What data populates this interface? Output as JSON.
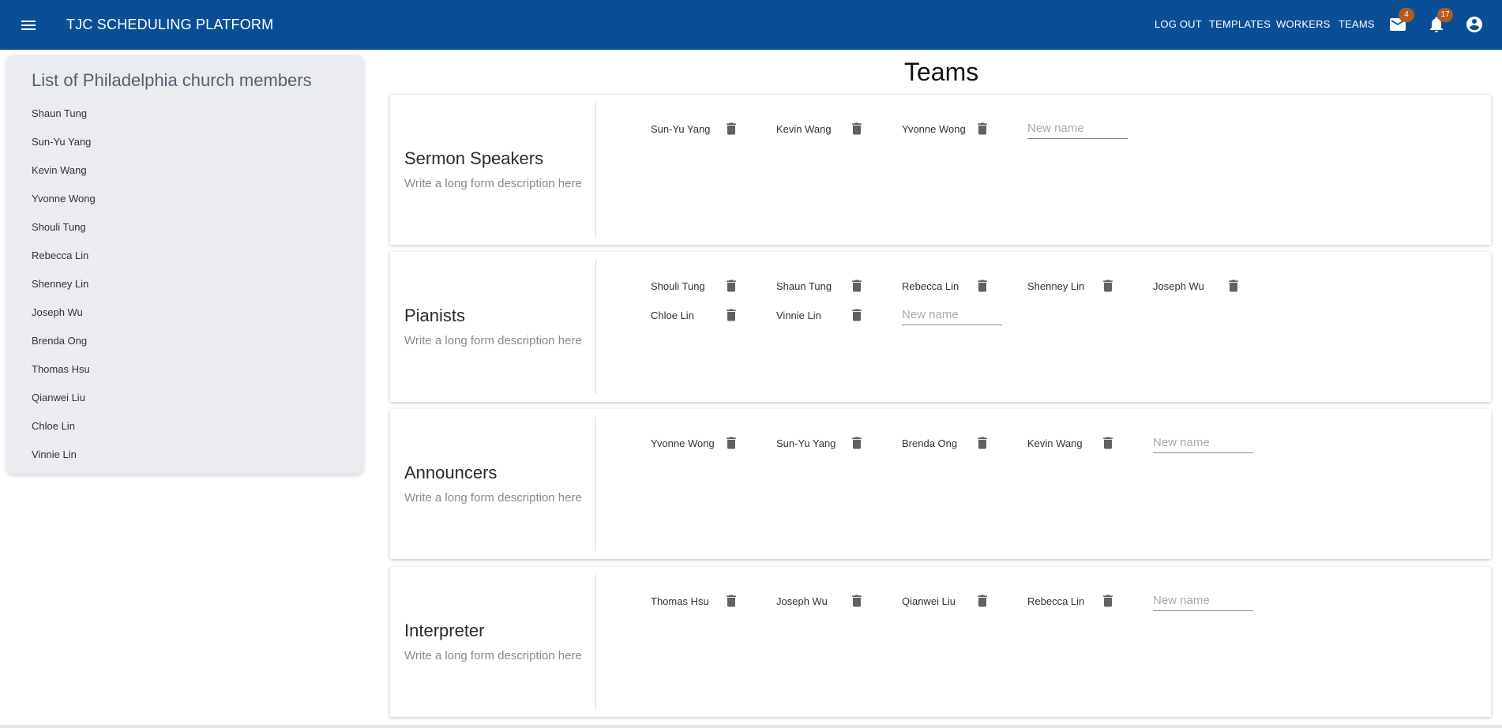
{
  "app": {
    "title": "TJC SCHEDULING PLATFORM",
    "nav": {
      "logout": "LOG OUT",
      "templates": "TEMPLATES",
      "workers": "WORKERS",
      "teams": "TEAMS"
    },
    "mail_badge": "4",
    "notification_badge": "17",
    "icons": {
      "menu": "hamburger-menu-icon",
      "mail": "mail-icon",
      "bell": "bell-icon",
      "account": "account-circle-icon",
      "delete": "trash-icon"
    },
    "colors": {
      "appbar": "#0a4f95",
      "badge": "#b35a1f",
      "panel": "#eaecf0"
    }
  },
  "members_panel": {
    "title": "List of Philadelphia church members",
    "members": [
      "Shaun Tung",
      "Sun-Yu Yang",
      "Kevin Wang",
      "Yvonne Wong",
      "Shouli Tung",
      "Rebecca Lin",
      "Shenney Lin",
      "Joseph Wu",
      "Brenda Ong",
      "Thomas Hsu",
      "Qianwei Liu",
      "Chloe Lin",
      "Vinnie Lin"
    ]
  },
  "page_title": "Teams",
  "new_name_placeholder": "New name",
  "teams": [
    {
      "name": "Sermon Speakers",
      "description": "Write a long form description here",
      "members": [
        "Sun-Yu Yang",
        "Kevin Wang",
        "Yvonne Wong"
      ]
    },
    {
      "name": "Pianists",
      "description": "Write a long form description here",
      "members": [
        "Shouli Tung",
        "Shaun Tung",
        "Rebecca Lin",
        "Shenney Lin",
        "Joseph Wu",
        "Chloe Lin",
        "Vinnie Lin"
      ]
    },
    {
      "name": "Announcers",
      "description": "Write a long form description here",
      "members": [
        "Yvonne Wong",
        "Sun-Yu Yang",
        "Brenda Ong",
        "Kevin Wang"
      ]
    },
    {
      "name": "Interpreter",
      "description": "Write a long form description here",
      "members": [
        "Thomas Hsu",
        "Joseph Wu",
        "Qianwei Liu",
        "Rebecca Lin"
      ]
    }
  ]
}
